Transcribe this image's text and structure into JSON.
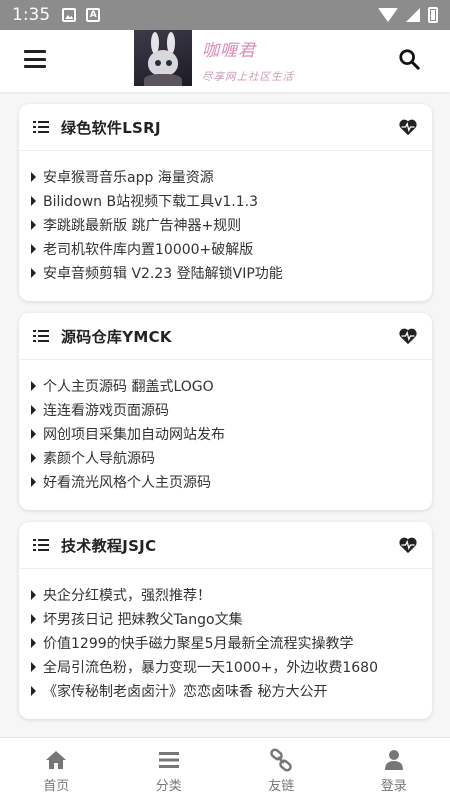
{
  "status_bar": {
    "time": "1:35",
    "icons": [
      "image-icon",
      "a-icon",
      "wifi-icon",
      "signal-icon",
      "battery-icon"
    ]
  },
  "header": {
    "logo_title": "咖喱君",
    "logo_subtitle": "尽享网上社区生活",
    "icons": [
      "menu-icon",
      "search-icon"
    ]
  },
  "sections": [
    {
      "title": "绿色软件LSRJ",
      "items": [
        "安卓猴哥音乐app 海量资源",
        "Bilidown B站视频下载工具v1.1.3",
        "李跳跳最新版 跳广告神器+规则",
        "老司机软件库内置10000+破解版",
        "安卓音频剪辑 V2.23 登陆解锁VIP功能"
      ]
    },
    {
      "title": "源码仓库YMCK",
      "items": [
        "个人主页源码 翻盖式LOGO",
        "连连看游戏页面源码",
        "网创项目采集加自动网站发布",
        "素颜个人导航源码",
        "好看流光风格个人主页源码"
      ]
    },
    {
      "title": "技术教程JSJC",
      "items": [
        "央企分红模式，强烈推荐！",
        "坏男孩日记 把妹教父Tango文集",
        "价值1299的快手磁力聚星5月最新全流程实操教学",
        "全局引流色粉，暴力变现一天1000+，外边收费1680",
        "《家传秘制老卤卤汁》恋恋卤味香 秘方大公开"
      ]
    }
  ],
  "bottom_nav": [
    {
      "label": "首页",
      "icon": "home-icon"
    },
    {
      "label": "分类",
      "icon": "category-icon"
    },
    {
      "label": "友链",
      "icon": "link-icon"
    },
    {
      "label": "登录",
      "icon": "user-icon"
    }
  ],
  "colors": {
    "status_bar": "#8c8c8c",
    "background": "#f6f6f6",
    "card": "#ffffff",
    "text": "#333333",
    "nav_text": "#777777",
    "logo_pink": "#d98bb5"
  }
}
